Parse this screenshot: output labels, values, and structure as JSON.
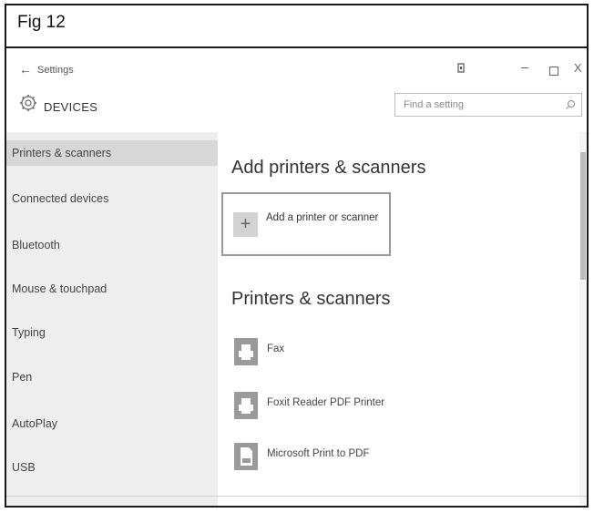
{
  "figure": {
    "label": "Fig 12"
  },
  "window": {
    "title": "Settings",
    "icons": [
      "back-arrow-icon",
      "snap-icon",
      "minimize-icon",
      "maximize-icon",
      "close-icon"
    ],
    "minimize_glyph": "–",
    "close_glyph": "X"
  },
  "header": {
    "section_title": "DEVICES",
    "icon": "gear-icon",
    "search": {
      "placeholder": "Find a setting",
      "icon": "search-icon"
    }
  },
  "sidebar": {
    "items": [
      {
        "label": "Printers & scanners",
        "active": true
      },
      {
        "label": "Connected devices"
      },
      {
        "label": "Bluetooth"
      },
      {
        "label": "Mouse & touchpad"
      },
      {
        "label": "Typing"
      },
      {
        "label": "Pen"
      },
      {
        "label": "AutoPlay"
      },
      {
        "label": "USB"
      }
    ]
  },
  "main": {
    "add_heading": "Add printers & scanners",
    "add_button": {
      "label": "Add a printer or scanner",
      "icon": "plus-icon",
      "glyph": "+"
    },
    "list_heading": "Printers & scanners",
    "printers": [
      {
        "name": "Fax",
        "icon": "fax-printer-icon"
      },
      {
        "name": "Foxit Reader PDF Printer",
        "icon": "printer-icon"
      },
      {
        "name": "Microsoft Print to PDF",
        "icon": "pdf-printer-icon"
      }
    ]
  },
  "colors": {
    "sidebar_bg": "#eeeeee",
    "active_item_bg": "#d7d7d7",
    "printer_tile": "#9a9a9a"
  }
}
